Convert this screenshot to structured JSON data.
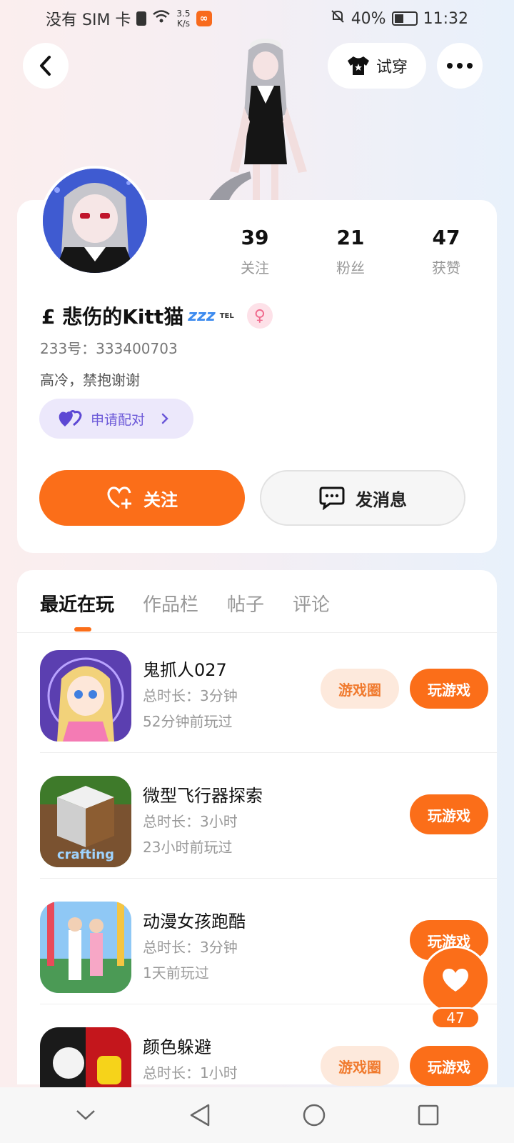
{
  "status_bar": {
    "carrier": "没有 SIM 卡",
    "speed_value": "3.5",
    "speed_unit": "K/s",
    "battery": "40%",
    "time": "11:32"
  },
  "top_bar": {
    "try_on_label": "试穿"
  },
  "profile": {
    "stats": [
      {
        "value": "39",
        "label": "关注"
      },
      {
        "value": "21",
        "label": "粉丝"
      },
      {
        "value": "47",
        "label": "获赞"
      }
    ],
    "nickname": "£ 悲伤的Kitt猫",
    "nickname_zzz": "zzz",
    "nickname_tel": "TEL",
    "gender_symbol": "♀",
    "uid": "233号：333400703",
    "bio": "高冷，禁抱谢谢",
    "pair_label": "申请配对",
    "follow_label": "关注",
    "message_label": "发消息"
  },
  "tabs": [
    {
      "label": "最近在玩",
      "active": true
    },
    {
      "label": "作品栏",
      "active": false
    },
    {
      "label": "帖子",
      "active": false
    },
    {
      "label": "评论",
      "active": false
    }
  ],
  "games": [
    {
      "title": "鬼抓人027",
      "total_time": "总时长：3分钟",
      "last_played": "52分钟前玩过",
      "has_circle": true,
      "circle_label": "游戏圈",
      "play_label": "玩游戏"
    },
    {
      "title": "微型飞行器探索",
      "total_time": "总时长：3小时",
      "last_played": "23小时前玩过",
      "has_circle": false,
      "play_label": "玩游戏",
      "icon_text": "crafting"
    },
    {
      "title": "动漫女孩跑酷",
      "total_time": "总时长：3分钟",
      "last_played": "1天前玩过",
      "has_circle": false,
      "play_label": "玩游戏"
    },
    {
      "title": "颜色躲避",
      "total_time": "总时长：1小时",
      "last_played": "",
      "has_circle": true,
      "circle_label": "游戏圈",
      "play_label": "玩游戏"
    }
  ],
  "floating_like": {
    "count": "47"
  },
  "colors": {
    "accent": "#fb6e19",
    "pair_purple": "#6b58d8"
  }
}
